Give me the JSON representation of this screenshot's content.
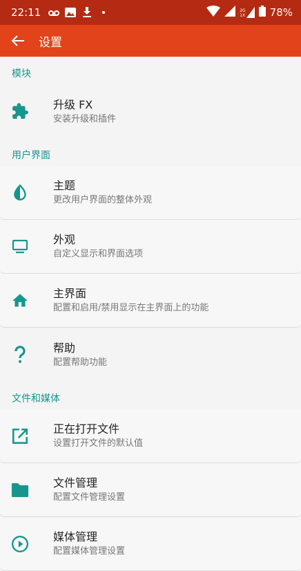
{
  "status_bar": {
    "time": "22:11",
    "battery": "78%",
    "network_top": "2G",
    "network_bottom": "1X"
  },
  "app_bar": {
    "title": "设置"
  },
  "sections": [
    {
      "header": "模块",
      "items": [
        {
          "title": "升级 FX",
          "subtitle": "安装升级和插件",
          "icon": "puzzle-icon"
        }
      ]
    },
    {
      "header": "用户界面",
      "items": [
        {
          "title": "主题",
          "subtitle": "更改用户界面的整体外观",
          "icon": "contrast-icon"
        },
        {
          "title": "外观",
          "subtitle": "自定义显示和界面选项",
          "icon": "monitor-icon"
        },
        {
          "title": "主界面",
          "subtitle": "配置和启用/禁用显示在主界面上的功能",
          "icon": "home-icon"
        },
        {
          "title": "帮助",
          "subtitle": "配置帮助功能",
          "icon": "help-icon"
        }
      ]
    },
    {
      "header": "文件和媒体",
      "items": [
        {
          "title": "正在打开文件",
          "subtitle": "设置打开文件的默认值",
          "icon": "open-external-icon"
        },
        {
          "title": "文件管理",
          "subtitle": "配置文件管理设置",
          "icon": "folder-icon"
        },
        {
          "title": "媒体管理",
          "subtitle": "配置媒体管理设置",
          "icon": "play-circle-icon"
        }
      ]
    }
  ],
  "colors": {
    "status_bar": "#b52a12",
    "app_bar": "#e2431b",
    "accent": "#17968e",
    "background": "#f4f4f4"
  }
}
